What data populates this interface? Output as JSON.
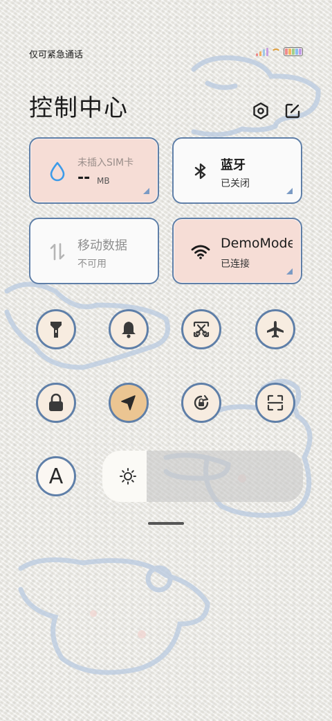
{
  "status": {
    "carrier": "仅可紧急通话"
  },
  "header": {
    "title": "控制中心"
  },
  "tiles": {
    "data_usage": {
      "name": "未插入SIM卡",
      "value": "--",
      "unit": "MB"
    },
    "bluetooth": {
      "name": "蓝牙",
      "state": "已关闭"
    },
    "mobile_data": {
      "name": "移动数据",
      "state": "不可用"
    },
    "wifi": {
      "name": "DemoMode",
      "state": "已连接"
    }
  },
  "toggles": [
    {
      "name": "flashlight-icon",
      "active": false
    },
    {
      "name": "bell-icon",
      "active": false
    },
    {
      "name": "screenshot-icon",
      "active": false
    },
    {
      "name": "airplane-icon",
      "active": false
    },
    {
      "name": "lock-icon",
      "active": false
    },
    {
      "name": "location-icon",
      "active": true
    },
    {
      "name": "auto-rotate-icon",
      "active": false
    },
    {
      "name": "scan-icon",
      "active": false
    }
  ],
  "font_button": {
    "label": "A"
  },
  "brightness": {
    "level": 0.22
  },
  "colors": {
    "tile_border": "#5f7fa8",
    "tile_pink": "#f6ddd6",
    "toggle_bg": "#f7ece0",
    "toggle_active": "#ebc592",
    "data_drop": "#3d9be9"
  }
}
